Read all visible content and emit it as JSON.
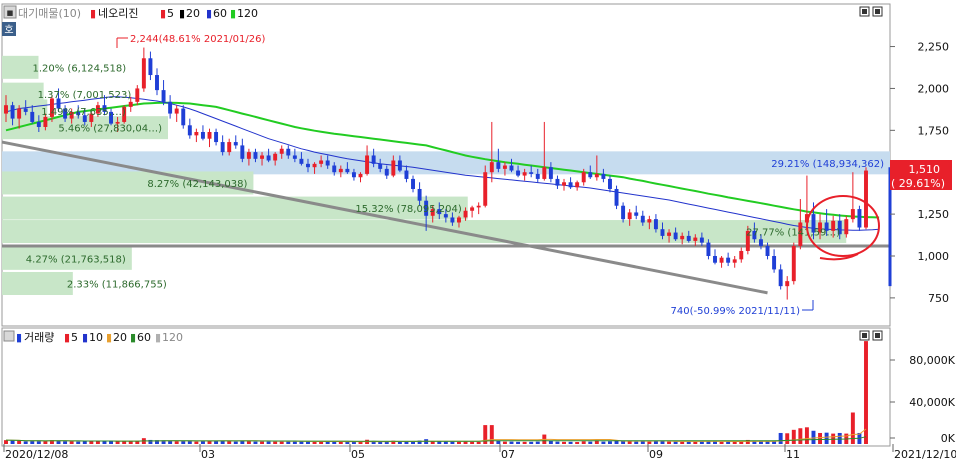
{
  "legend": {
    "price": [
      "대기매물(10)",
      "네오리진",
      "5",
      "20",
      "60",
      "120"
    ],
    "volume": [
      "거래량",
      "5",
      "10",
      "20",
      "60",
      "120"
    ]
  },
  "colors": {
    "up": "#e8202a",
    "down": "#1f3fd6",
    "ma5": "#c8101a",
    "ma20": "#000000",
    "ma60": "#2233cc",
    "ma120": "#22cc22",
    "profile": "#c8e6c8",
    "profile_hi": "#c6dcef",
    "trend": "#8a8a8a",
    "vol_ma20": "#e8a030",
    "vol_ma60": "#2a8a2a",
    "vol_ma120": "#b0b0b0"
  },
  "chart_data": {
    "type": "candlestick",
    "x_ticks": [
      "2020/12/08",
      "03",
      "05",
      "07",
      "09",
      "11",
      "2021/12/10"
    ],
    "y_ticks": [
      "2,250",
      "2,000",
      "1,750",
      "1,500",
      "1,250",
      "1,000",
      "750"
    ],
    "y_range": [
      650,
      2400
    ],
    "volume_ticks": [
      "80,000K",
      "40,000K",
      "0K"
    ],
    "volume_range": [
      0,
      100000
    ],
    "current_price": "1,510",
    "current_change": "( 29.61%)",
    "annotations": {
      "high": "2,244(48.61% 2021/01/26)",
      "low": "740(-50.99% 2021/11/11)"
    },
    "volume_profile": [
      {
        "label": "1.20% (6,124,518)",
        "price": 2120,
        "pct": 1.2
      },
      {
        "label": "1.37% (7,001,523)",
        "price": 1960,
        "pct": 1.37
      },
      {
        "label": "1.49% (7,635,…)",
        "price": 1860,
        "pct": 1.49
      },
      {
        "label": "5.46% (27,830,04…)",
        "price": 1760,
        "pct": 5.46
      },
      {
        "label": "29.21% (148,934,362)",
        "price": 1550,
        "pct": 29.21
      },
      {
        "label": "8.27% (42,143,038)",
        "price": 1430,
        "pct": 8.27
      },
      {
        "label": "15.32% (78,095,204)",
        "price": 1280,
        "pct": 15.32
      },
      {
        "label": "27.77% (141,59…)",
        "price": 1140,
        "pct": 27.77
      },
      {
        "label": "4.27% (21,763,518)",
        "price": 980,
        "pct": 4.27
      },
      {
        "label": "2.33% (11,866,755)",
        "price": 830,
        "pct": 2.33
      }
    ],
    "support_line": 1060,
    "candles": [
      [
        1850,
        1960,
        1800,
        1900
      ],
      [
        1900,
        1920,
        1780,
        1820
      ],
      [
        1820,
        1900,
        1760,
        1880
      ],
      [
        1880,
        1930,
        1840,
        1860
      ],
      [
        1860,
        1900,
        1790,
        1800
      ],
      [
        1800,
        1840,
        1740,
        1770
      ],
      [
        1770,
        1850,
        1750,
        1830
      ],
      [
        1830,
        1960,
        1800,
        1940
      ],
      [
        1940,
        2000,
        1860,
        1880
      ],
      [
        1880,
        1900,
        1800,
        1820
      ],
      [
        1820,
        1880,
        1790,
        1860
      ],
      [
        1860,
        1900,
        1820,
        1840
      ],
      [
        1840,
        1880,
        1780,
        1800
      ],
      [
        1800,
        1860,
        1770,
        1850
      ],
      [
        1850,
        1920,
        1830,
        1900
      ],
      [
        1900,
        1960,
        1840,
        1860
      ],
      [
        1860,
        1880,
        1780,
        1790
      ],
      [
        1790,
        1830,
        1740,
        1800
      ],
      [
        1800,
        1900,
        1790,
        1890
      ],
      [
        1890,
        1950,
        1860,
        1920
      ],
      [
        1920,
        2020,
        1900,
        2000
      ],
      [
        2000,
        2244,
        1980,
        2180
      ],
      [
        2180,
        2220,
        2050,
        2080
      ],
      [
        2080,
        2120,
        1960,
        1990
      ],
      [
        1990,
        2050,
        1900,
        1920
      ],
      [
        1920,
        1960,
        1820,
        1850
      ],
      [
        1850,
        1900,
        1800,
        1880
      ],
      [
        1880,
        1900,
        1760,
        1780
      ],
      [
        1780,
        1820,
        1700,
        1720
      ],
      [
        1720,
        1760,
        1680,
        1740
      ],
      [
        1740,
        1780,
        1690,
        1700
      ],
      [
        1700,
        1760,
        1650,
        1740
      ],
      [
        1740,
        1760,
        1660,
        1680
      ],
      [
        1680,
        1720,
        1600,
        1620
      ],
      [
        1620,
        1700,
        1600,
        1680
      ],
      [
        1680,
        1720,
        1640,
        1660
      ],
      [
        1660,
        1700,
        1560,
        1580
      ],
      [
        1580,
        1640,
        1540,
        1620
      ],
      [
        1620,
        1640,
        1560,
        1580
      ],
      [
        1580,
        1620,
        1540,
        1600
      ],
      [
        1600,
        1640,
        1560,
        1570
      ],
      [
        1570,
        1620,
        1540,
        1610
      ],
      [
        1610,
        1660,
        1580,
        1640
      ],
      [
        1640,
        1660,
        1580,
        1600
      ],
      [
        1600,
        1640,
        1560,
        1580
      ],
      [
        1580,
        1620,
        1540,
        1550
      ],
      [
        1550,
        1580,
        1500,
        1530
      ],
      [
        1530,
        1560,
        1490,
        1550
      ],
      [
        1550,
        1600,
        1530,
        1570
      ],
      [
        1570,
        1600,
        1520,
        1540
      ],
      [
        1540,
        1560,
        1480,
        1500
      ],
      [
        1500,
        1540,
        1470,
        1520
      ],
      [
        1520,
        1560,
        1490,
        1500
      ],
      [
        1500,
        1520,
        1450,
        1470
      ],
      [
        1470,
        1500,
        1440,
        1490
      ],
      [
        1490,
        1660,
        1480,
        1600
      ],
      [
        1600,
        1640,
        1530,
        1550
      ],
      [
        1550,
        1580,
        1500,
        1520
      ],
      [
        1520,
        1540,
        1460,
        1480
      ],
      [
        1480,
        1600,
        1470,
        1570
      ],
      [
        1570,
        1600,
        1500,
        1510
      ],
      [
        1510,
        1540,
        1440,
        1460
      ],
      [
        1460,
        1480,
        1380,
        1400
      ],
      [
        1400,
        1440,
        1300,
        1330
      ],
      [
        1330,
        1360,
        1150,
        1240
      ],
      [
        1240,
        1300,
        1200,
        1280
      ],
      [
        1280,
        1320,
        1220,
        1250
      ],
      [
        1250,
        1280,
        1200,
        1230
      ],
      [
        1230,
        1260,
        1180,
        1200
      ],
      [
        1200,
        1240,
        1170,
        1230
      ],
      [
        1230,
        1290,
        1210,
        1270
      ],
      [
        1270,
        1300,
        1230,
        1290
      ],
      [
        1290,
        1320,
        1250,
        1300
      ],
      [
        1300,
        1540,
        1290,
        1500
      ],
      [
        1500,
        1800,
        1440,
        1560
      ],
      [
        1560,
        1640,
        1500,
        1520
      ],
      [
        1520,
        1560,
        1480,
        1540
      ],
      [
        1540,
        1580,
        1500,
        1510
      ],
      [
        1510,
        1540,
        1470,
        1480
      ],
      [
        1480,
        1520,
        1450,
        1500
      ],
      [
        1500,
        1540,
        1470,
        1490
      ],
      [
        1490,
        1520,
        1440,
        1460
      ],
      [
        1460,
        1800,
        1450,
        1530
      ],
      [
        1530,
        1560,
        1440,
        1460
      ],
      [
        1460,
        1480,
        1400,
        1420
      ],
      [
        1420,
        1460,
        1390,
        1440
      ],
      [
        1440,
        1470,
        1400,
        1410
      ],
      [
        1410,
        1450,
        1390,
        1440
      ],
      [
        1440,
        1520,
        1420,
        1500
      ],
      [
        1500,
        1540,
        1460,
        1470
      ],
      [
        1470,
        1600,
        1450,
        1490
      ],
      [
        1490,
        1520,
        1440,
        1460
      ],
      [
        1460,
        1480,
        1380,
        1400
      ],
      [
        1400,
        1420,
        1280,
        1300
      ],
      [
        1300,
        1320,
        1200,
        1220
      ],
      [
        1220,
        1280,
        1180,
        1260
      ],
      [
        1260,
        1300,
        1220,
        1240
      ],
      [
        1240,
        1270,
        1180,
        1200
      ],
      [
        1200,
        1240,
        1160,
        1220
      ],
      [
        1220,
        1250,
        1140,
        1160
      ],
      [
        1160,
        1200,
        1100,
        1120
      ],
      [
        1120,
        1160,
        1080,
        1140
      ],
      [
        1140,
        1170,
        1090,
        1100
      ],
      [
        1100,
        1140,
        1070,
        1120
      ],
      [
        1120,
        1150,
        1080,
        1090
      ],
      [
        1090,
        1130,
        1060,
        1110
      ],
      [
        1110,
        1140,
        1060,
        1080
      ],
      [
        1080,
        1100,
        980,
        1000
      ],
      [
        1000,
        1040,
        950,
        960
      ],
      [
        960,
        1000,
        930,
        990
      ],
      [
        990,
        1020,
        940,
        960
      ],
      [
        960,
        1000,
        930,
        980
      ],
      [
        980,
        1050,
        960,
        1030
      ],
      [
        1030,
        1180,
        1010,
        1150
      ],
      [
        1150,
        1200,
        1080,
        1100
      ],
      [
        1100,
        1130,
        1040,
        1060
      ],
      [
        1060,
        1080,
        980,
        1000
      ],
      [
        1000,
        1040,
        900,
        920
      ],
      [
        920,
        950,
        800,
        820
      ],
      [
        820,
        880,
        740,
        850
      ],
      [
        850,
        1080,
        830,
        1060
      ],
      [
        1060,
        1340,
        1040,
        1200
      ],
      [
        1200,
        1480,
        1150,
        1250
      ],
      [
        1250,
        1320,
        1100,
        1140
      ],
      [
        1140,
        1250,
        1100,
        1200
      ],
      [
        1200,
        1280,
        1120,
        1150
      ],
      [
        1150,
        1240,
        1110,
        1210
      ],
      [
        1210,
        1250,
        1100,
        1130
      ],
      [
        1130,
        1240,
        1110,
        1220
      ],
      [
        1220,
        1500,
        1200,
        1280
      ],
      [
        1280,
        1300,
        1150,
        1170
      ],
      [
        1170,
        1530,
        1160,
        1510
      ]
    ],
    "ma120": [
      1750,
      1760,
      1770,
      1780,
      1790,
      1800,
      1810,
      1820,
      1830,
      1840,
      1850,
      1860,
      1865,
      1870,
      1875,
      1880,
      1885,
      1890,
      1895,
      1900,
      1905,
      1910,
      1912,
      1914,
      1915,
      1915,
      1914,
      1912,
      1910,
      1905,
      1900,
      1895,
      1890,
      1880,
      1870,
      1860,
      1850,
      1840,
      1830,
      1820,
      1810,
      1800,
      1790,
      1780,
      1770,
      1762,
      1755,
      1748,
      1742,
      1736,
      1730,
      1725,
      1720,
      1715,
      1710,
      1705,
      1700,
      1695,
      1690,
      1685,
      1680,
      1675,
      1670,
      1665,
      1660,
      1650,
      1640,
      1630,
      1620,
      1610,
      1600,
      1592,
      1585,
      1578,
      1572,
      1566,
      1560,
      1555,
      1550,
      1545,
      1540,
      1535,
      1530,
      1525,
      1520,
      1515,
      1510,
      1505,
      1500,
      1495,
      1490,
      1485,
      1480,
      1475,
      1470,
      1462,
      1455,
      1448,
      1440,
      1432,
      1425,
      1418,
      1410,
      1402,
      1395,
      1388,
      1380,
      1372,
      1365,
      1358,
      1350,
      1343,
      1336,
      1329,
      1322,
      1315,
      1308,
      1300,
      1293,
      1286,
      1279,
      1272,
      1265,
      1260,
      1255,
      1250,
      1246,
      1242,
      1239,
      1236,
      1234,
      1232,
      1231,
      1230
    ],
    "ma60": [
      1860,
      1870,
      1880,
      1885,
      1890,
      1895,
      1900,
      1905,
      1910,
      1915,
      1920,
      1925,
      1930,
      1935,
      1940,
      1945,
      1950,
      1950,
      1948,
      1945,
      1940,
      1935,
      1930,
      1925,
      1918,
      1910,
      1900,
      1890,
      1878,
      1865,
      1850,
      1835,
      1820,
      1805,
      1790,
      1775,
      1760,
      1745,
      1730,
      1715,
      1700,
      1688,
      1676,
      1664,
      1652,
      1640,
      1630,
      1620,
      1612,
      1604,
      1596,
      1588,
      1580,
      1574,
      1568,
      1562,
      1556,
      1550,
      1546,
      1542,
      1538,
      1534,
      1530,
      1524,
      1518,
      1512,
      1506,
      1500,
      1494,
      1488,
      1482,
      1478,
      1474,
      1470,
      1466,
      1462,
      1458,
      1454,
      1450,
      1446,
      1442,
      1438,
      1434,
      1430,
      1426,
      1422,
      1418,
      1414,
      1410,
      1406,
      1400,
      1394,
      1388,
      1382,
      1376,
      1370,
      1364,
      1358,
      1352,
      1346,
      1340,
      1334,
      1326,
      1318,
      1310,
      1302,
      1294,
      1286,
      1278,
      1270,
      1262,
      1254,
      1246,
      1238,
      1230,
      1222,
      1214,
      1206,
      1198,
      1190,
      1182,
      1176,
      1170,
      1166,
      1162,
      1160,
      1158,
      1156,
      1155,
      1154,
      1154,
      1155,
      1157,
      1160
    ]
  }
}
